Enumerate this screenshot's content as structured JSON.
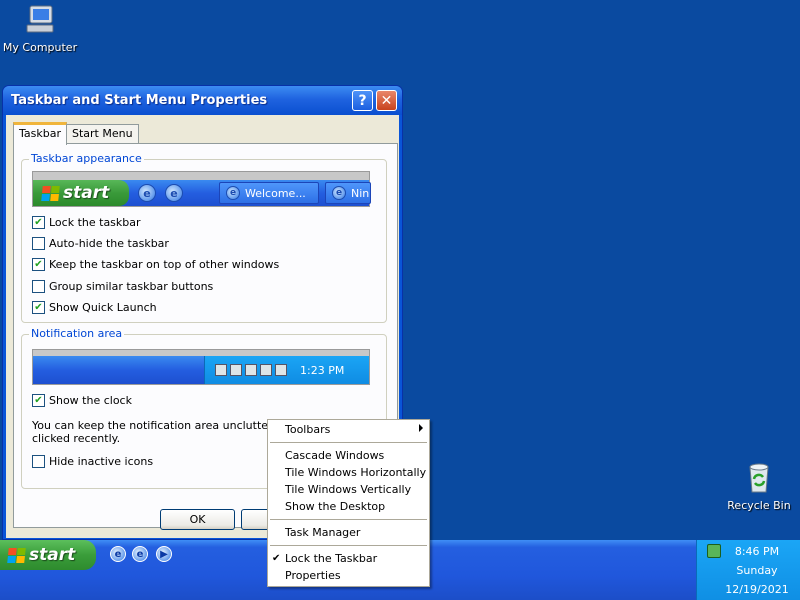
{
  "desktop": {
    "icons": [
      {
        "label": "My Computer",
        "icon": "my-computer-icon"
      },
      {
        "label": "Recycle Bin",
        "icon": "recycle-bin-icon"
      }
    ]
  },
  "window": {
    "title": "Taskbar and Start Menu Properties",
    "help_button": "?",
    "close_button": "✕",
    "tabs": [
      {
        "label": "Taskbar",
        "active": true
      },
      {
        "label": "Start Menu",
        "active": false
      }
    ],
    "appearance": {
      "legend": "Taskbar appearance",
      "preview": {
        "start_label": "start",
        "tasks": [
          "Welcome...",
          "Nin"
        ]
      },
      "options": [
        {
          "label": "Lock the taskbar",
          "checked": true
        },
        {
          "label": "Auto-hide the taskbar",
          "checked": false
        },
        {
          "label": "Keep the taskbar on top of other windows",
          "checked": true
        },
        {
          "label": "Group similar taskbar buttons",
          "checked": false
        },
        {
          "label": "Show Quick Launch",
          "checked": true
        }
      ]
    },
    "notification": {
      "legend": "Notification area",
      "preview_time": "1:23 PM",
      "show_clock": {
        "label": "Show the clock",
        "checked": true
      },
      "help_text": "You can keep the notification area uncluttered by have not clicked recently.",
      "hide_inactive": {
        "label": "Hide inactive icons",
        "checked": false
      }
    },
    "buttons": {
      "ok": "OK",
      "cancel": "C"
    }
  },
  "context_menu": {
    "items": [
      {
        "label": "Toolbars",
        "submenu": true
      },
      {
        "label": "Cascade Windows"
      },
      {
        "label": "Tile Windows Horizontally"
      },
      {
        "label": "Tile Windows Vertically"
      },
      {
        "label": "Show the Desktop"
      },
      {
        "label": "Task Manager"
      },
      {
        "label": "Lock the Taskbar",
        "checked": true
      },
      {
        "label": "Properties"
      }
    ]
  },
  "taskbar": {
    "start_label": "start",
    "clock": {
      "time": "8:46 PM",
      "day": "Sunday",
      "date": "12/19/2021"
    }
  },
  "colors": {
    "desktop": "#0a4aa0",
    "title_bar": "#0a55d8",
    "start_green": "#3a9d3a",
    "tray_blue": "#0f8fe4"
  }
}
